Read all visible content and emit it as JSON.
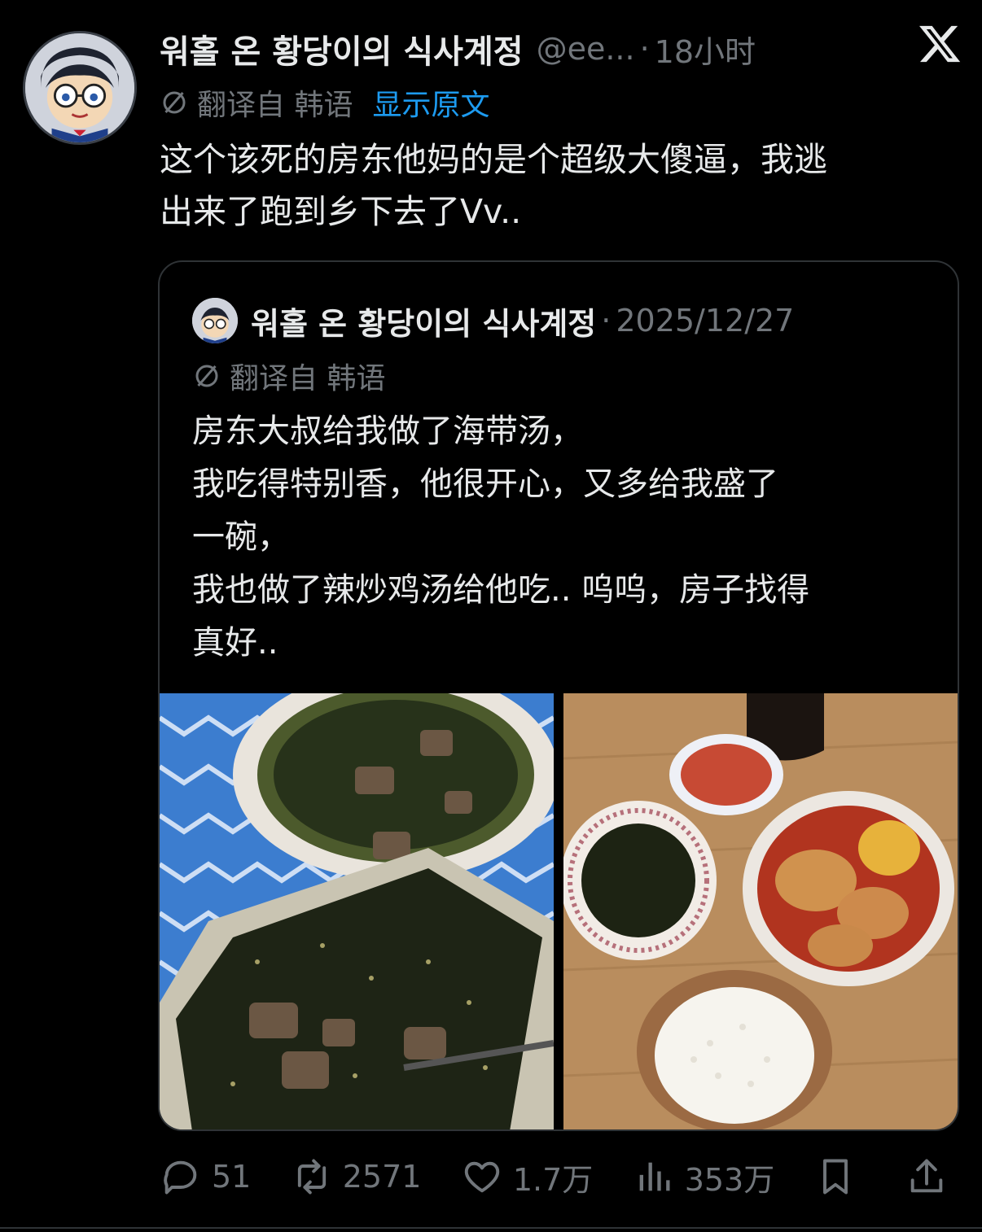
{
  "post": {
    "display_name": "워홀 온 황당이의 식사계정",
    "handle": "@ee...",
    "separator": "·",
    "time": "18小时",
    "translate_label": "翻译自 韩语",
    "show_original": "显示原文",
    "text_lines": [
      "这个该死的房东他妈的是个超级大傻逼，我逃",
      "出来了跑到乡下去了Vv.."
    ]
  },
  "quote": {
    "display_name": "워홀 온 황당이의 식사계정",
    "separator": "·",
    "date": "2025/12/27",
    "translate_label": "翻译自 韩语",
    "text_lines": [
      "房东大叔给我做了海带汤，",
      "我吃得特别香，他很开心，又多给我盛了",
      "一碗，",
      "我也做了辣炒鸡汤给他吃.. 呜呜，房子找得",
      "真好.."
    ],
    "photos": [
      {
        "subject": "seaweed-soup-bowl-and-container-icon"
      },
      {
        "subject": "table-meal-icon"
      }
    ]
  },
  "actions": {
    "replies": "51",
    "reposts": "2571",
    "likes": "1.7万",
    "views": "353万"
  },
  "icons": {
    "logo": "x-logo-icon",
    "translate": "not-equal-icon",
    "reply": "reply-icon",
    "repost": "repost-icon",
    "like": "heart-icon",
    "views": "bar-chart-icon",
    "bookmark": "bookmark-icon",
    "share": "share-icon"
  },
  "colors": {
    "background": "#000000",
    "text": "#e7e9ea",
    "muted": "#71767b",
    "link": "#1d9bf0",
    "border": "#2f3336"
  }
}
